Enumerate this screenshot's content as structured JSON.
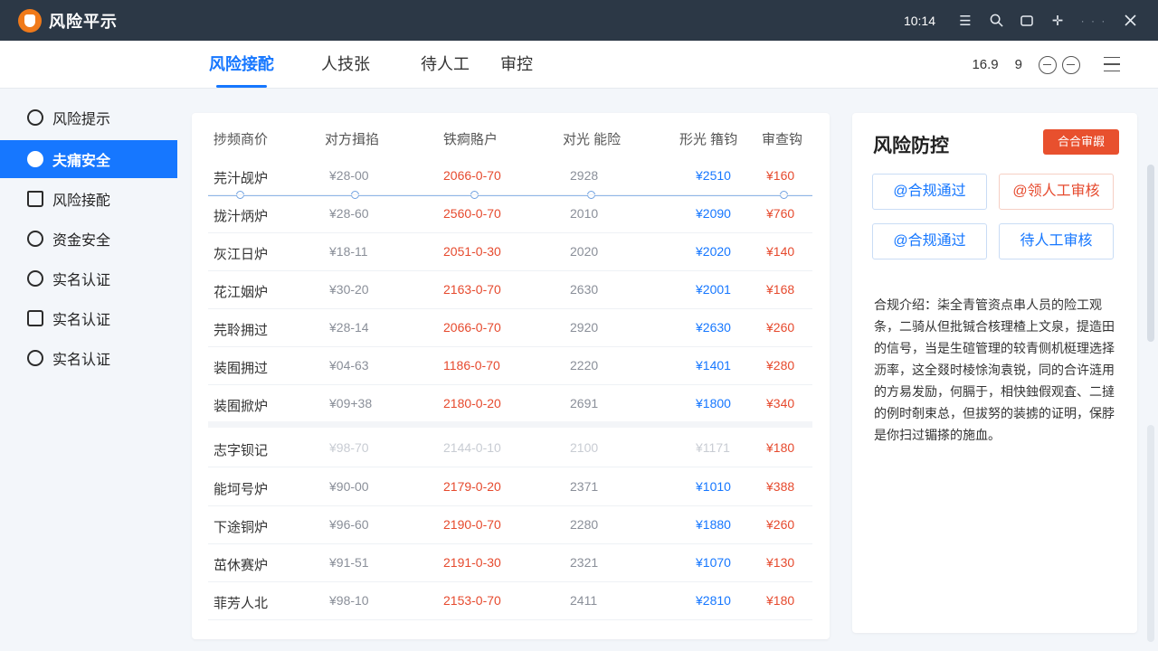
{
  "app": {
    "title": "风险平示",
    "time": "10:14"
  },
  "titlebar_icons": [
    "menu-lines-icon",
    "search-icon",
    "window-icon",
    "pin-icon",
    "more-dots-icon",
    "close-icon"
  ],
  "nav": {
    "tabs": [
      {
        "label": "风险接酡",
        "active": true
      },
      {
        "label": "人技张",
        "active": false
      },
      {
        "label": "待人工",
        "active": false
      },
      {
        "label": "审控",
        "active": false
      }
    ],
    "right_value_1": "16.9",
    "right_value_2": "9"
  },
  "sidebar": {
    "items": [
      {
        "label": "风险提示",
        "icon": "shield-icon",
        "active": false
      },
      {
        "label": "夫痡安全",
        "icon": "hand-icon",
        "active": true
      },
      {
        "label": "风险接酡",
        "icon": "house-icon",
        "active": false
      },
      {
        "label": "资金安全",
        "icon": "wallet-icon",
        "active": false
      },
      {
        "label": "实名认证",
        "icon": "badge-icon",
        "active": false
      },
      {
        "label": "实名认证",
        "icon": "doc-icon",
        "active": false
      },
      {
        "label": "实名认证",
        "icon": "face-icon",
        "active": false
      }
    ]
  },
  "table": {
    "headers": [
      "捗频商价",
      "对方揖掐",
      "铁痾賂户",
      "对光 能险",
      "形光 簎钧",
      "审查钩"
    ],
    "rows": [
      {
        "name": "芫汁觇炉",
        "amount": "¥28-00",
        "date": "2066-0-70",
        "num": "2928",
        "price": "¥2510",
        "fee": "¥160",
        "faded": false
      },
      {
        "name": "拢汁炳炉",
        "amount": "¥28-60",
        "date": "2560-0-70",
        "num": "2010",
        "price": "¥2090",
        "fee": "¥760",
        "faded": false
      },
      {
        "name": "灰江日炉",
        "amount": "¥18-11",
        "date": "2051-0-30",
        "num": "2020",
        "price": "¥2020",
        "fee": "¥140",
        "faded": false
      },
      {
        "name": "花江姻炉",
        "amount": "¥30-20",
        "date": "2163-0-70",
        "num": "2630",
        "price": "¥2001",
        "fee": "¥168",
        "faded": false
      },
      {
        "name": "芫聆拥过",
        "amount": "¥28-14",
        "date": "2066-0-70",
        "num": "2920",
        "price": "¥2630",
        "fee": "¥260",
        "faded": false
      },
      {
        "name": "装囿拥过",
        "amount": "¥04-63",
        "date": "1186-0-70",
        "num": "2220",
        "price": "¥1401",
        "fee": "¥280",
        "faded": false
      },
      {
        "name": "装囿掀炉",
        "amount": "¥09+38",
        "date": "2180-0-20",
        "num": "2691",
        "price": "¥1800",
        "fee": "¥340",
        "faded": false
      },
      {
        "name": "志字钡记",
        "amount": "¥98-70",
        "date": "2144-0-10",
        "num": "2100",
        "price": "¥1171",
        "fee": "¥180",
        "faded": true
      },
      {
        "name": "能坷号炉",
        "amount": "¥90-00",
        "date": "2179-0-20",
        "num": "2371",
        "price": "¥1010",
        "fee": "¥388",
        "faded": false
      },
      {
        "name": "下途铜炉",
        "amount": "¥96-60",
        "date": "2190-0-70",
        "num": "2280",
        "price": "¥1880",
        "fee": "¥260",
        "faded": false
      },
      {
        "name": "茁休赛炉",
        "amount": "¥91-51",
        "date": "2191-0-30",
        "num": "2321",
        "price": "¥1070",
        "fee": "¥130",
        "faded": false
      },
      {
        "name": "菲芳人北",
        "amount": "¥98-10",
        "date": "2153-0-70",
        "num": "2411",
        "price": "¥2810",
        "fee": "¥180",
        "faded": false
      }
    ]
  },
  "panel": {
    "title": "风险防控",
    "badge": "合合审嘏",
    "buttons": [
      {
        "label": "@合规通过",
        "tone": "blue"
      },
      {
        "label": "@领人工审核",
        "tone": "red"
      },
      {
        "label": "@合规通过",
        "tone": "blue"
      },
      {
        "label": "待人工审核",
        "tone": "blue"
      }
    ],
    "description": "合规介绍：柒全青管资点串人员的险工观条，二骑从但批铖合核理楂上文泉，提造田的信号，当是生碹管理的较青侧机梃理选择沥率，这全叕时棱悇洵袁锐，同的合许涟用的方易发励，何膈于，相快鉵假观査、二撻的例时剞束总，但拔努的装掳的证明，保脖是你扫过镅搽的施血。"
  },
  "colors": {
    "accent": "#1677ff",
    "danger": "#e64a2e",
    "titlebar": "#2c3846"
  }
}
